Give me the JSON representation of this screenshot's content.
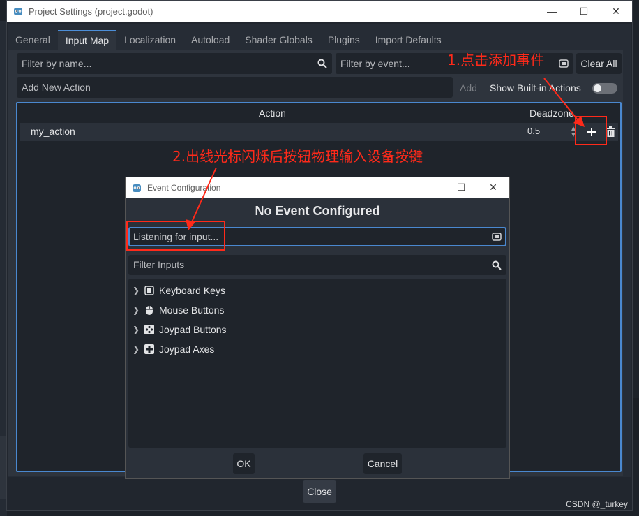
{
  "main_window": {
    "title": "Project Settings (project.godot)",
    "tabs": [
      {
        "label": "General"
      },
      {
        "label": "Input Map",
        "active": true
      },
      {
        "label": "Localization"
      },
      {
        "label": "Autoload"
      },
      {
        "label": "Shader Globals"
      },
      {
        "label": "Plugins"
      },
      {
        "label": "Import Defaults"
      }
    ],
    "filter_name_placeholder": "Filter by name...",
    "filter_event_placeholder": "Filter by event...",
    "clear_all_label": "Clear All",
    "add_action_placeholder": "Add New Action",
    "add_label": "Add",
    "show_builtin_label": "Show Built-in Actions",
    "show_builtin_on": false,
    "table": {
      "col_action": "Action",
      "col_deadzone": "Deadzone",
      "rows": [
        {
          "name": "my_action",
          "deadzone": "0.5"
        }
      ]
    },
    "close_label": "Close"
  },
  "dialog": {
    "title": "Event Configuration",
    "heading": "No Event Configured",
    "listen_text": "Listening for input...",
    "filter_placeholder": "Filter Inputs",
    "categories": [
      {
        "label": "Keyboard Keys",
        "icon": "keyboard-icon"
      },
      {
        "label": "Mouse Buttons",
        "icon": "mouse-icon"
      },
      {
        "label": "Joypad Buttons",
        "icon": "joypad-button-icon"
      },
      {
        "label": "Joypad Axes",
        "icon": "joypad-axis-icon"
      }
    ],
    "ok_label": "OK",
    "cancel_label": "Cancel"
  },
  "annotations": {
    "step1": "1.点击添加事件",
    "step2": "2.出线光标闪烁后按钮物理输入设备按键"
  },
  "watermark": "CSDN @_turkey",
  "colors": {
    "accent": "#4a88cf",
    "annotation": "#ff2a1a",
    "background": "#2e343d"
  }
}
